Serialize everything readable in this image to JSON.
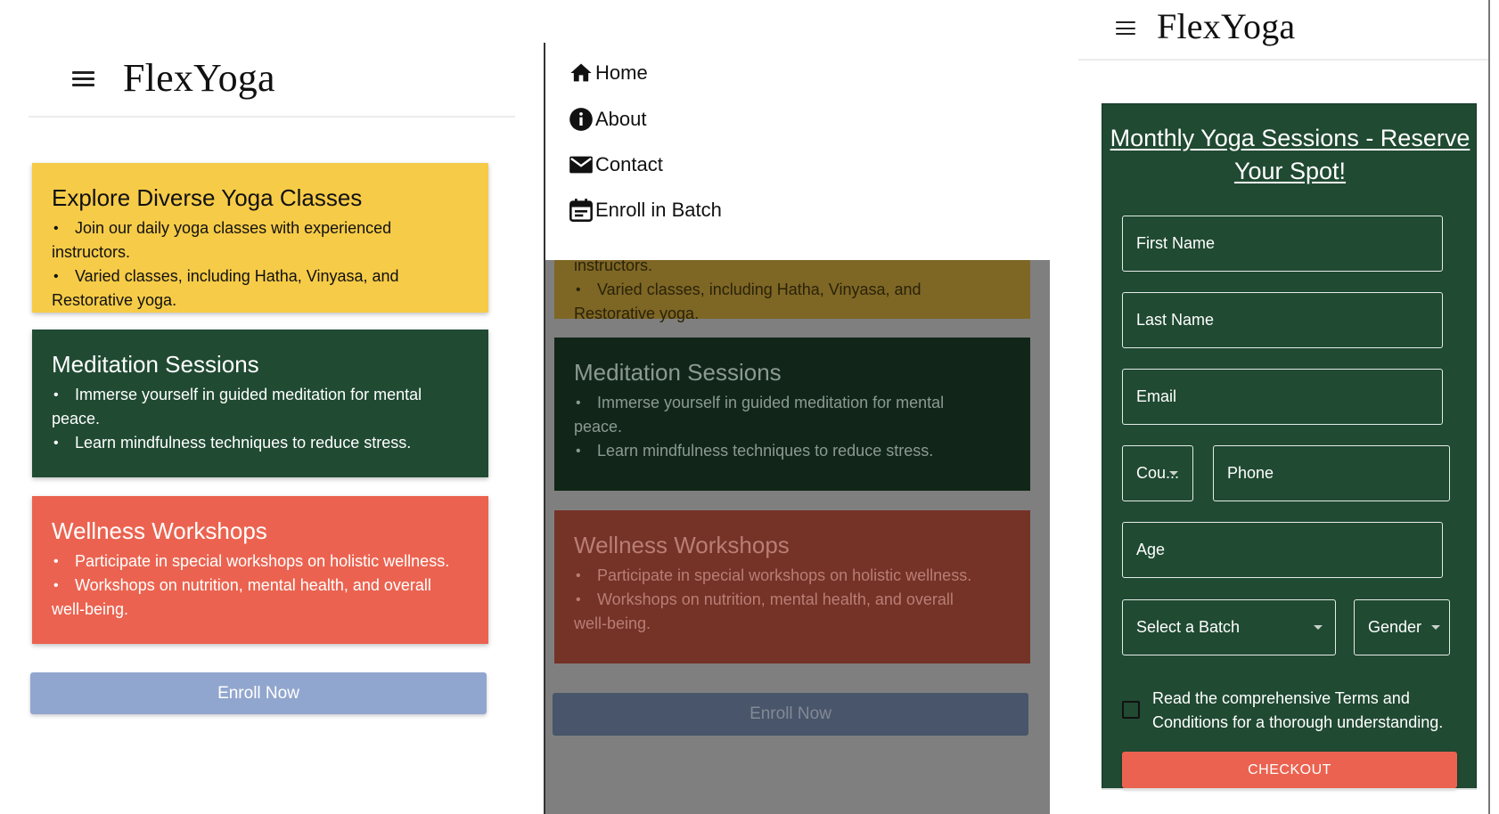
{
  "brand": {
    "logo": "FlexYoga"
  },
  "cards": [
    {
      "title": "Explore Diverse Yoga Classes",
      "items": [
        {
          "first": "Join our daily yoga classes with experienced",
          "rest": "instructors."
        },
        {
          "first": "Varied classes, including Hatha, Vinyasa, and",
          "rest": "Restorative yoga."
        }
      ]
    },
    {
      "title": "Meditation Sessions",
      "items": [
        {
          "first": "Immerse yourself in guided meditation for mental",
          "rest": "peace."
        },
        {
          "first": "Learn mindfulness techniques to reduce stress.",
          "rest": ""
        }
      ]
    },
    {
      "title": "Wellness Workshops",
      "items": [
        {
          "first": "Participate in special workshops on holistic wellness.",
          "rest": ""
        },
        {
          "first": "Workshops on nutrition, mental health, and overall",
          "rest": "well-being."
        }
      ]
    }
  ],
  "enroll_button": "Enroll Now",
  "nav": {
    "home": "Home",
    "about": "About",
    "contact": "Contact",
    "enroll": "Enroll in Batch"
  },
  "form": {
    "title": "Monthly Yoga Sessions - Reserve Your Spot!",
    "first_name": "First Name",
    "last_name": "Last Name",
    "email": "Email",
    "country": "Cou...",
    "phone": "Phone",
    "age": "Age",
    "batch": "Select a Batch",
    "gender": "Gender",
    "terms": "Read the comprehensive Terms and Conditions for a thorough understanding.",
    "checkout": "CHECKOUT"
  },
  "colors": {
    "yellow_card": "#f6cb47",
    "green_card": "#204a32",
    "red_card": "#eb6350",
    "enroll_button": "#91a6ce",
    "overlay": "#7f7f7f"
  },
  "icons": [
    "menu-icon",
    "home-icon",
    "info-icon",
    "mail-icon",
    "calendar-icon",
    "chevron-down-icon",
    "checkbox-icon"
  ]
}
